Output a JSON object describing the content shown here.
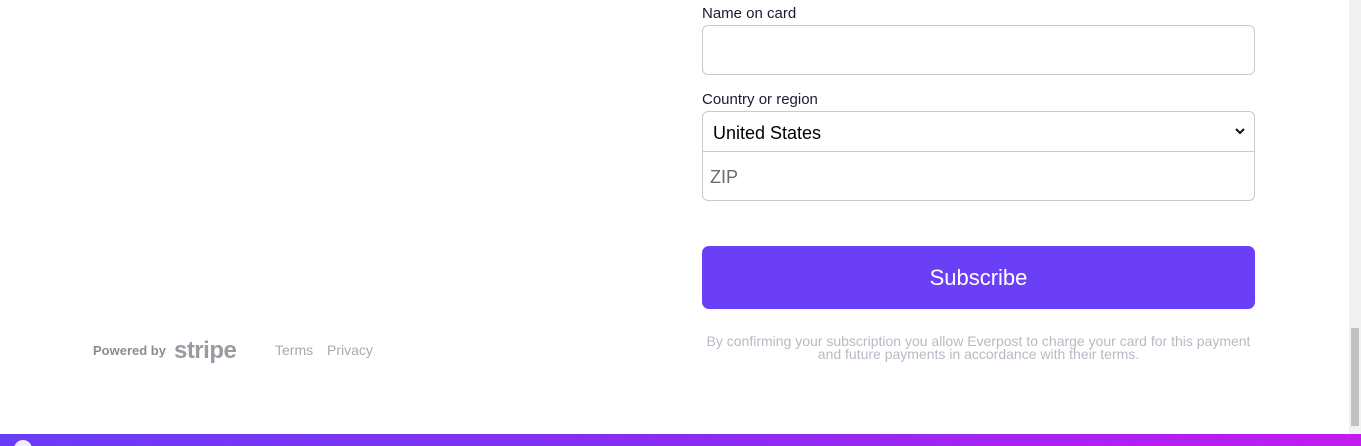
{
  "form": {
    "name_label": "Name on card",
    "name_value": "",
    "country_label": "Country or region",
    "country_value": "United States",
    "zip_placeholder": "ZIP",
    "subscribe_label": "Subscribe",
    "consent_text": "By confirming your subscription you allow Everpost to charge your card for this payment and future payments in accordance with their terms."
  },
  "footer": {
    "powered_by": "Powered by",
    "brand": "stripe",
    "terms": "Terms",
    "privacy": "Privacy"
  },
  "colors": {
    "accent": "#6b3ff6",
    "gradient_start": "#6a3df5",
    "gradient_end": "#c21bf0"
  },
  "icons": {
    "select_chevron": "chevron-down-icon",
    "scroll_down": "arrow-down-icon"
  }
}
